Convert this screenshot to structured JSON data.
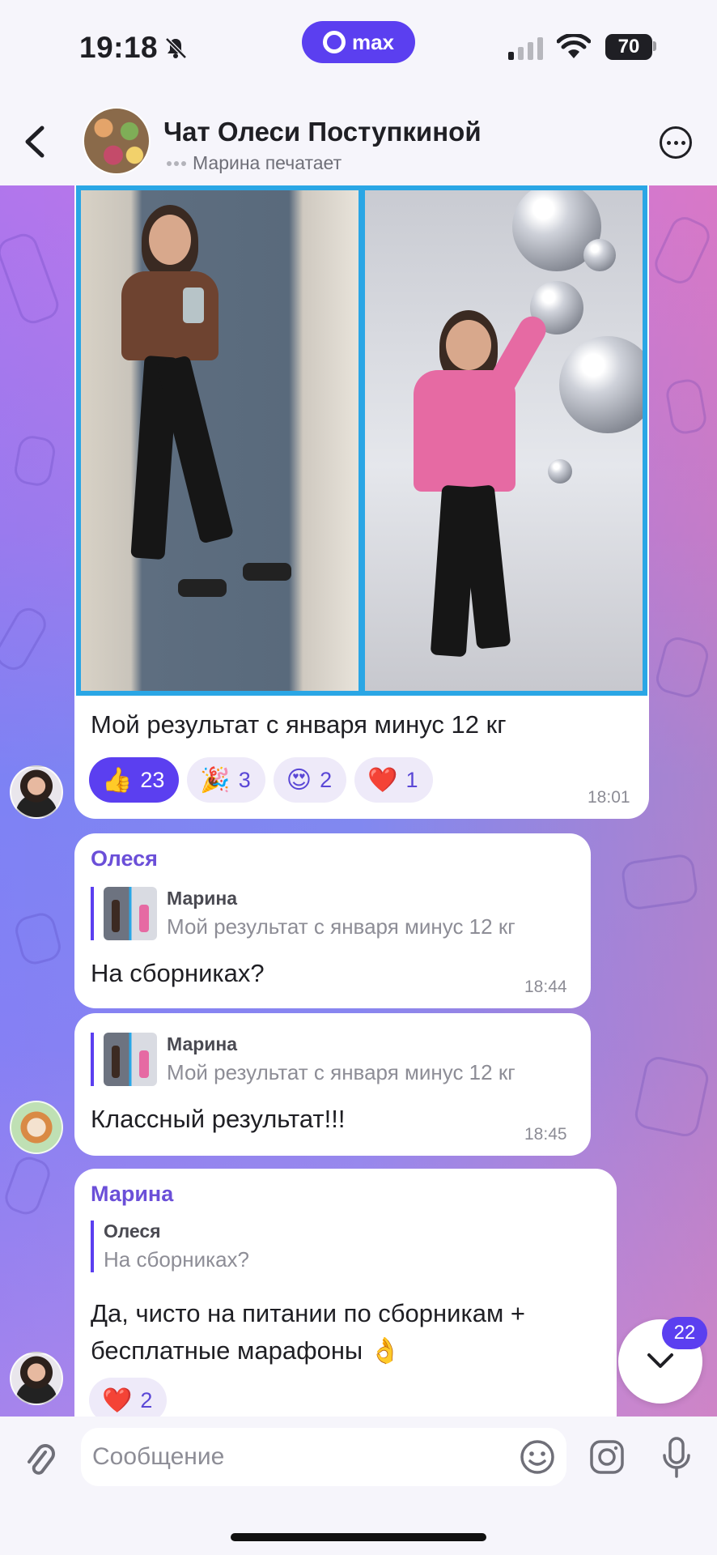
{
  "status": {
    "time": "19:18",
    "brand": "max",
    "battery": "70"
  },
  "header": {
    "title": "Чат Олеси Поступкиной",
    "subtitle": "Марина печатает"
  },
  "messages": [
    {
      "caption": "Мой результат с января минус 12 кг",
      "time": "18:01",
      "reactions": [
        {
          "emoji": "👍",
          "count": "23"
        },
        {
          "emoji": "🎉",
          "count": "3"
        },
        {
          "emoji": "😍",
          "count": "2"
        },
        {
          "emoji": "❤️",
          "count": "1"
        }
      ]
    },
    {
      "sender": "Олеся",
      "quote_name": "Марина",
      "quote_text": "Мой результат с января минус 12 кг",
      "text": "На сборниках?",
      "time": "18:44"
    },
    {
      "quote_name": "Марина",
      "quote_text": "Мой результат с января минус 12 кг",
      "text": "Классный результат!!!",
      "time": "18:45"
    },
    {
      "sender": "Марина",
      "quote_name": "Олеся",
      "quote_text": "На сборниках?",
      "text_line1": "Да, чисто на питании по сборникам +",
      "text_line2": "бесплатные марафоны 👌",
      "reaction_emoji": "❤️",
      "reaction_count": "2"
    }
  ],
  "unread_count": "22",
  "composer": {
    "placeholder": "Сообщение"
  }
}
